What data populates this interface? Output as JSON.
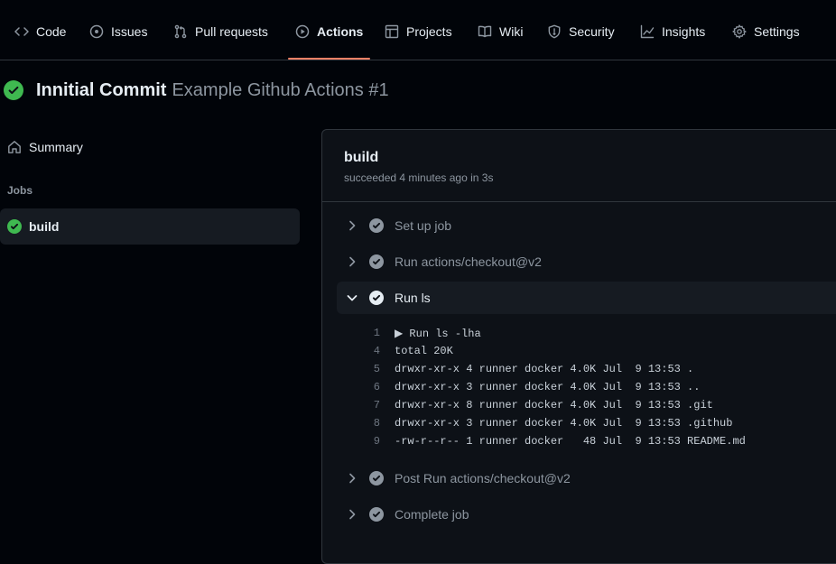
{
  "tabs": [
    {
      "label": "Code",
      "icon": "code-icon",
      "active": false
    },
    {
      "label": "Issues",
      "icon": "issue-opened-icon",
      "active": false
    },
    {
      "label": "Pull requests",
      "icon": "git-pull-request-icon",
      "active": false
    },
    {
      "label": "Actions",
      "icon": "play-icon",
      "active": true
    },
    {
      "label": "Projects",
      "icon": "table-icon",
      "active": false
    },
    {
      "label": "Wiki",
      "icon": "book-icon",
      "active": false
    },
    {
      "label": "Security",
      "icon": "shield-icon",
      "active": false
    },
    {
      "label": "Insights",
      "icon": "graph-icon",
      "active": false
    },
    {
      "label": "Settings",
      "icon": "gear-icon",
      "active": false
    }
  ],
  "run": {
    "commit_title": "Innitial Commit",
    "workflow_label": "Example Github Actions #1",
    "status": "success"
  },
  "sidebar": {
    "summary_label": "Summary",
    "jobs_heading": "Jobs",
    "jobs": [
      {
        "label": "build",
        "status": "success"
      }
    ]
  },
  "job_panel": {
    "title": "build",
    "subtitle": "succeeded 4 minutes ago in 3s",
    "steps": [
      {
        "label": "Set up job",
        "expanded": false
      },
      {
        "label": "Run actions/checkout@v2",
        "expanded": false
      },
      {
        "label": "Run ls",
        "expanded": true
      },
      {
        "label": "Post Run actions/checkout@v2",
        "expanded": false
      },
      {
        "label": "Complete job",
        "expanded": false
      }
    ],
    "log_lines": [
      {
        "num": "1",
        "text": "▶ Run ls -lha"
      },
      {
        "num": "4",
        "text": "total 20K"
      },
      {
        "num": "5",
        "text": "drwxr-xr-x 4 runner docker 4.0K Jul  9 13:53 ."
      },
      {
        "num": "6",
        "text": "drwxr-xr-x 3 runner docker 4.0K Jul  9 13:53 .."
      },
      {
        "num": "7",
        "text": "drwxr-xr-x 8 runner docker 4.0K Jul  9 13:53 .git"
      },
      {
        "num": "8",
        "text": "drwxr-xr-x 3 runner docker 4.0K Jul  9 13:53 .github"
      },
      {
        "num": "9",
        "text": "-rw-r--r-- 1 runner docker   48 Jul  9 13:53 README.md"
      }
    ]
  },
  "colors": {
    "success": "#3fb950",
    "active_tab_underline": "#f78166",
    "background": "#010409",
    "panel_background": "#0d1117"
  }
}
